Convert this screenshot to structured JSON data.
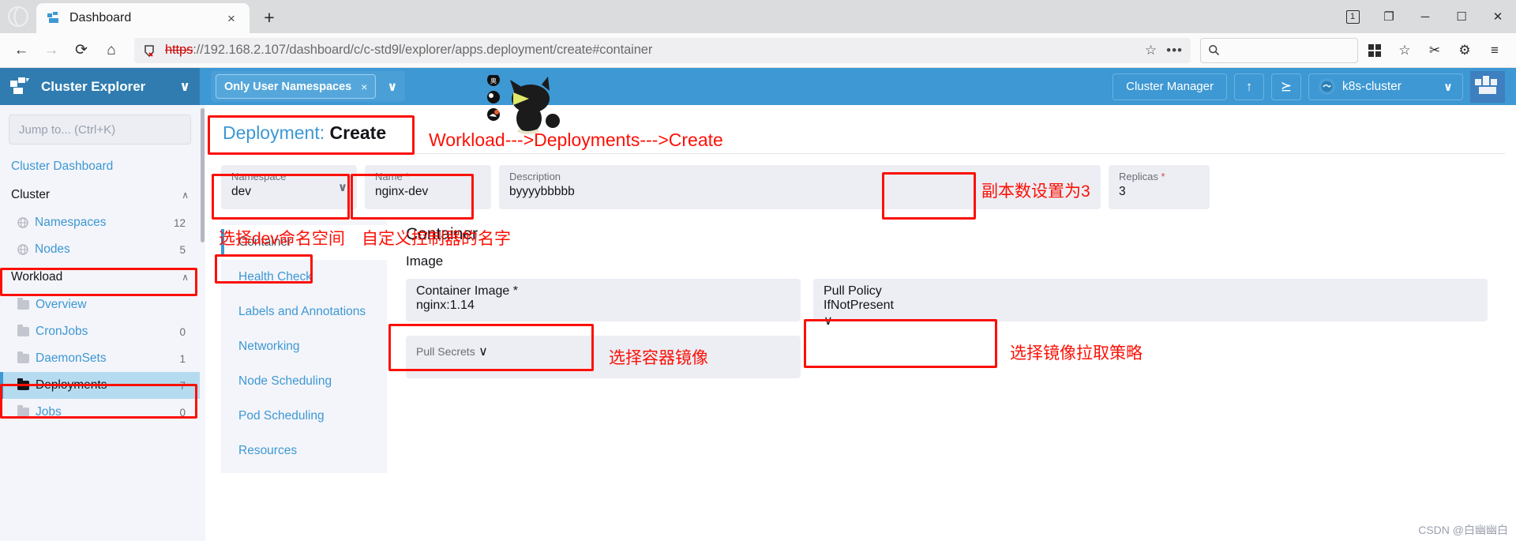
{
  "browser": {
    "tab_title": "Dashboard",
    "tab_favicon": "rancher-icon",
    "close_label": "×",
    "newtab_label": "+",
    "back_icon": "←",
    "forward_icon": "→",
    "reload_icon": "⟳",
    "home_icon": "⌂",
    "url_scheme": "https",
    "url_rest": "://192.168.2.107/dashboard/c/c-std9l/explorer/apps.deployment/create#container",
    "star_icon": "☆",
    "more_icon": "•••",
    "search_icon": "search-icon",
    "search_placeholder": "",
    "collections_icon": "⬚",
    "favorites_icon": "☆",
    "cut_icon": "✂",
    "settings_icon": "⚙",
    "menu_icon": "≡",
    "win_restore": "1",
    "win_split": "❐",
    "win_minimize": "─",
    "win_maximize": "☐",
    "win_close": "✕"
  },
  "sidebar": {
    "title": "Cluster Explorer",
    "collapse_caret": "∨",
    "search_placeholder": "Jump to... (Ctrl+K)",
    "dashboard_link": "Cluster Dashboard",
    "groups": [
      {
        "label": "Cluster",
        "caret": "∧",
        "items": [
          {
            "label": "Namespaces",
            "count": "12",
            "icon": "globe-icon",
            "active": false
          },
          {
            "label": "Nodes",
            "count": "5",
            "icon": "globe-icon",
            "active": false
          }
        ]
      },
      {
        "label": "Workload",
        "caret": "∧",
        "items": [
          {
            "label": "Overview",
            "count": "",
            "icon": "folder-icon",
            "active": false
          },
          {
            "label": "CronJobs",
            "count": "0",
            "icon": "folder-icon",
            "active": false
          },
          {
            "label": "DaemonSets",
            "count": "1",
            "icon": "folder-icon",
            "active": false
          },
          {
            "label": "Deployments",
            "count": "7",
            "icon": "folder-icon",
            "active": true
          },
          {
            "label": "Jobs",
            "count": "0",
            "icon": "folder-icon",
            "active": false
          }
        ]
      }
    ]
  },
  "topbar": {
    "namespace_filter": "Only User Namespaces",
    "namespace_clear": "×",
    "namespace_caret": "∨",
    "sidebar_caret": "∨",
    "cluster_manager": "Cluster Manager",
    "import_icon": "↑",
    "shell_icon": "⪰",
    "cluster_name": "k8s-cluster",
    "cluster_caret": "∨",
    "logo": "rancher-logo"
  },
  "page": {
    "title_prefix": "Deployment:",
    "title_action": "Create"
  },
  "form": {
    "namespace": {
      "label": "Namespace",
      "value": "dev",
      "required": false,
      "caret": "∨"
    },
    "name": {
      "label": "Name",
      "value": "nginx-dev",
      "required": true
    },
    "description": {
      "label": "Description",
      "value": "byyyybbbbb",
      "required": false
    },
    "replicas": {
      "label": "Replicas",
      "value": "3",
      "required": true
    }
  },
  "tabs": [
    {
      "label": "Container",
      "active": true
    },
    {
      "label": "Health Check",
      "active": false
    },
    {
      "label": "Labels and Annotations",
      "active": false
    },
    {
      "label": "Networking",
      "active": false
    },
    {
      "label": "Node Scheduling",
      "active": false
    },
    {
      "label": "Pod Scheduling",
      "active": false
    },
    {
      "label": "Resources",
      "active": false
    }
  ],
  "panel": {
    "heading": "Container",
    "subheading": "Image",
    "container_image": {
      "label": "Container Image",
      "value": "nginx:1.14",
      "required": true
    },
    "pull_policy": {
      "label": "Pull Policy",
      "value": "IfNotPresent",
      "required": false,
      "caret": "∨"
    },
    "pull_secrets": {
      "label": "Pull Secrets",
      "value": "",
      "caret": "∨"
    }
  },
  "annotations": {
    "breadcrumb_note": "Workload--->Deployments--->Create",
    "namespace_note": "选择dev命名空间",
    "name_note": "自定义控制器的名字",
    "replicas_note": "副本数设置为3",
    "image_note": "选择容器镜像",
    "pull_policy_note": "选择镜像拉取策略",
    "accent_color": "#fc1006"
  },
  "watermark": "CSDN @白幽幽白"
}
